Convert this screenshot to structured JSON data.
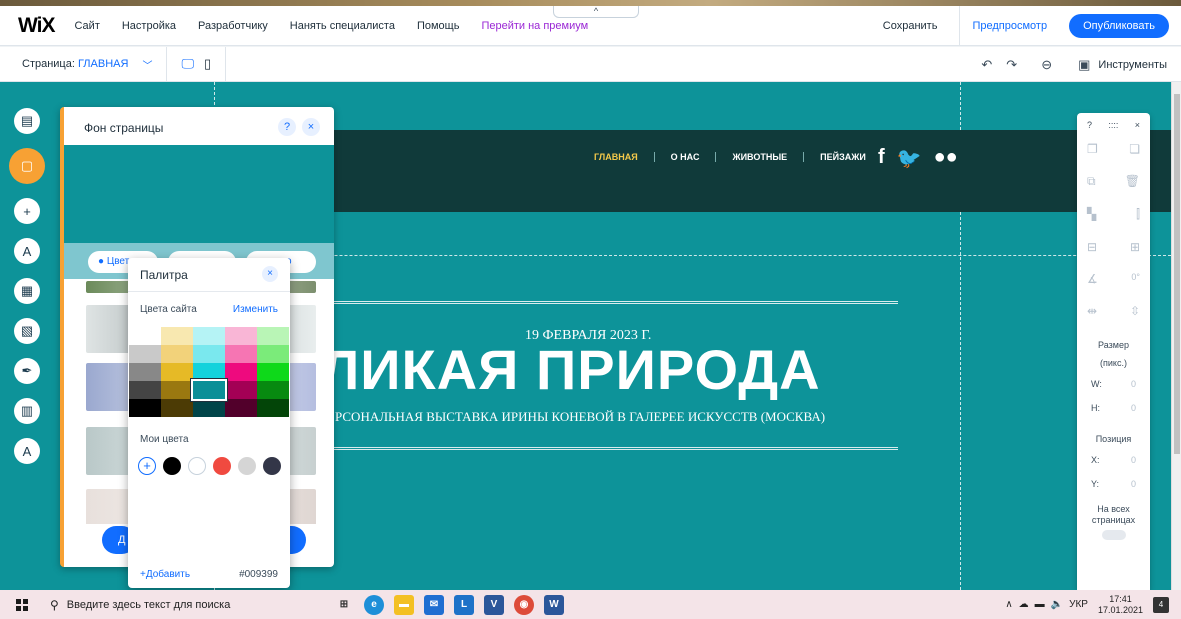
{
  "topbar": {
    "logo": "WiX",
    "menu": [
      "Сайт",
      "Настройка",
      "Разработчику",
      "Нанять специалиста",
      "Помощь",
      "Перейти на премиум"
    ],
    "collapse_glyph": "^",
    "save": "Сохранить",
    "preview": "Предпросмотр",
    "publish": "Опубликовать"
  },
  "toolbar": {
    "page_label": "Страница: ",
    "page_name": "ГЛАВНАЯ",
    "tools": "Инструменты"
  },
  "site": {
    "nav": [
      "ГЛАВНАЯ",
      "О НАС",
      "ЖИВОТНЫЕ",
      "ПЕЙЗАЖИ"
    ],
    "social": [
      "f",
      "🐦",
      "●●"
    ],
    "date": "19 ФЕВРАЛЯ 2023 Г.",
    "title": "ЛИКАЯ ПРИРОДА",
    "subtitle": "РСОНАЛЬНАЯ ВЫСТАВКА ИРИНЫ КОНЕВОЙ В ГАЛЕРЕЕ ИСКУССТВ (МОСКВА)"
  },
  "bg_panel": {
    "title": "Фон страницы",
    "help": "?",
    "close": "×",
    "tabs": [
      "Цвет",
      "",
      "о"
    ],
    "button_text": "Д"
  },
  "palette": {
    "title": "Палитра",
    "close": "×",
    "site_colors_label": "Цвета сайта",
    "edit": "Изменить",
    "grid": [
      [
        "#ffffff",
        "#f8e8b0",
        "#b5f3f5",
        "#f9b6d6",
        "#b9f5b6"
      ],
      [
        "#c9c9c9",
        "#f2d27a",
        "#7ae8ee",
        "#f675b3",
        "#7beb7a"
      ],
      [
        "#888888",
        "#e6ba26",
        "#14d2dc",
        "#ee0a7e",
        "#0ed91a"
      ],
      [
        "#444444",
        "#9a7810",
        "#0b8f97",
        "#a30055",
        "#078a10"
      ],
      [
        "#000000",
        "#4c3b05",
        "#014549",
        "#52002b",
        "#034508"
      ]
    ],
    "selected": "2,3",
    "my_colors_label": "Мои цвета",
    "my_colors": [
      "#000000",
      "#ffffff",
      "#f04a40",
      "#d5d5d5",
      "#333648"
    ],
    "add": "+Добавить",
    "hex": "#009399"
  },
  "right_panel": {
    "help": "?",
    "drag": "::::",
    "close": "×",
    "rotation": "0°",
    "size_label": "Размер (пикс.)",
    "w_label": "W:",
    "w_val": "0",
    "h_label": "H:",
    "h_val": "0",
    "pos_label": "Позиция",
    "x_label": "X:",
    "x_val": "0",
    "y_label": "Y:",
    "y_val": "0",
    "all_pages": "На всех страницах"
  },
  "taskbar": {
    "search": "Введите здесь текст для поиска",
    "lang": "УКР",
    "time": "17:41",
    "date": "17.01.2021",
    "notifications": "4"
  }
}
